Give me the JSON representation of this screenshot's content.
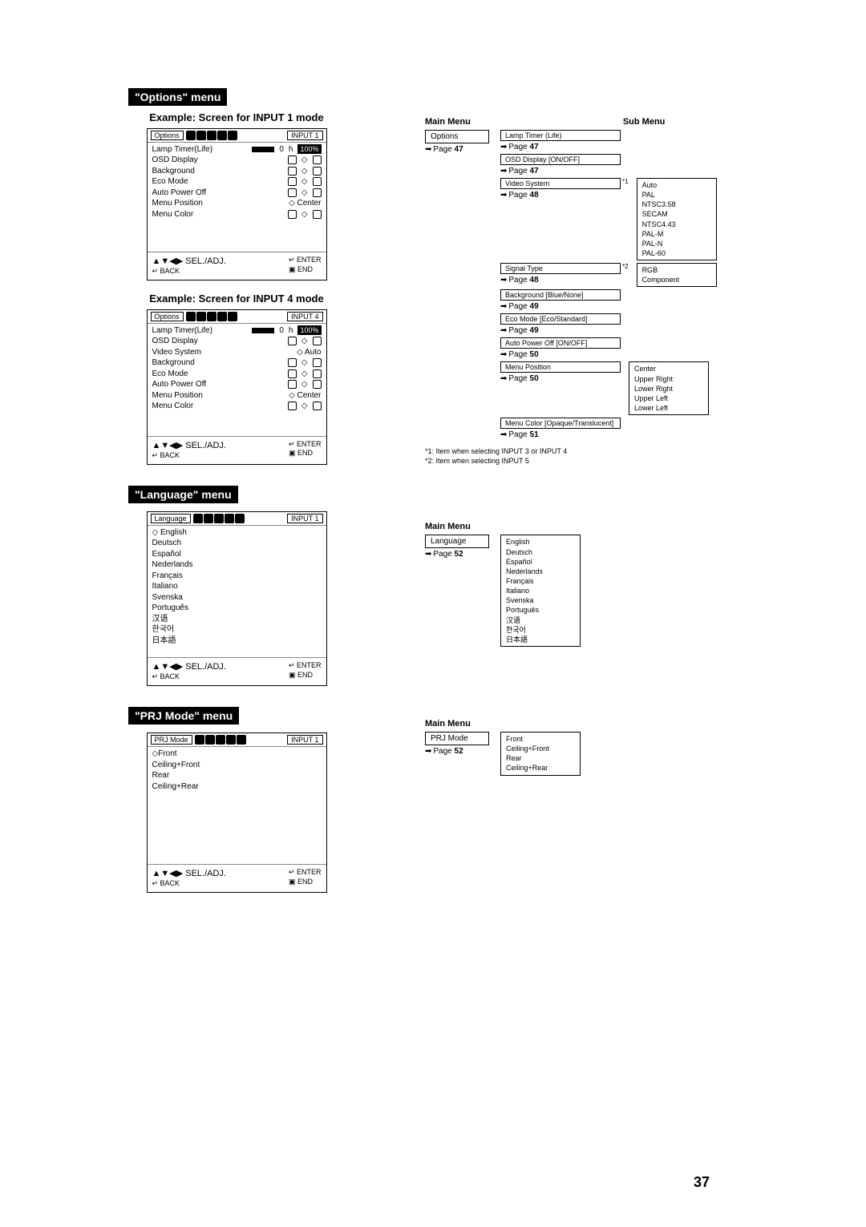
{
  "pageNumber": "37",
  "optionsMenu": {
    "header": "\"Options\" menu",
    "example1Title": "Example: Screen for INPUT 1 mode",
    "example4Title": "Example: Screen for INPUT 4 mode",
    "osd1": {
      "tab": "Options",
      "inputBadge": "INPUT 1",
      "rows": [
        {
          "label": "Lamp Timer(Life)",
          "right": "0_h_100"
        },
        {
          "label": "OSD Display",
          "right": "icons2"
        },
        {
          "label": "Background",
          "right": "icons2"
        },
        {
          "label": "Eco Mode",
          "right": "icons2"
        },
        {
          "label": "Auto Power Off",
          "right": "icons2"
        },
        {
          "label": "Menu Position",
          "right": "Center"
        },
        {
          "label": "Menu Color",
          "right": "icons2"
        }
      ]
    },
    "osd4": {
      "tab": "Options",
      "inputBadge": "INPUT 4",
      "rows": [
        {
          "label": "Lamp Timer(Life)",
          "right": "0_h_100"
        },
        {
          "label": "OSD Display",
          "right": "icons2"
        },
        {
          "label": "Video System",
          "right": "Auto"
        },
        {
          "label": "Background",
          "right": "icons2"
        },
        {
          "label": "Eco Mode",
          "right": "icons2"
        },
        {
          "label": "Auto Power Off",
          "right": "icons2"
        },
        {
          "label": "Menu Position",
          "right": "Center"
        },
        {
          "label": "Menu Color",
          "right": "icons2"
        }
      ]
    },
    "footer": {
      "left1": "▲▼◀▶ SEL./ADJ.",
      "left2": "↵ BACK",
      "right1": "↵ ENTER",
      "right2": "▣ END"
    },
    "tree": {
      "mainTitle": "Main Menu",
      "subTitle": "Sub Menu",
      "mainBox": "Options",
      "mainPage": "47",
      "items": [
        {
          "label": "Lamp Timer (Life)",
          "page": "47"
        },
        {
          "label": "OSD Display [ON/OFF]",
          "page": "47"
        },
        {
          "label": "Video System",
          "page": "48",
          "note": "*1",
          "opts": [
            "Auto",
            "PAL",
            "NTSC3.58",
            "SECAM",
            "NTSC4.43",
            "PAL-M",
            "PAL-N",
            "PAL-60"
          ]
        },
        {
          "label": "Signal Type",
          "page": "48",
          "note": "*2",
          "opts": [
            "RGB",
            "Component"
          ]
        },
        {
          "label": "Background [Blue/None]",
          "page": "49"
        },
        {
          "label": "Eco Mode [Eco/Standard]",
          "page": "49"
        },
        {
          "label": "Auto Power Off [ON/OFF]",
          "page": "50"
        },
        {
          "label": "Menu Position",
          "page": "50",
          "opts": [
            "Center",
            "Upper Right",
            "Lower Right",
            "Upper Left",
            "Lower Left"
          ]
        },
        {
          "label": "Menu Color [Opaque/Translucent]",
          "page": "51"
        }
      ],
      "notes": [
        "*1: Item when selecting INPUT 3 or INPUT 4",
        "*2: Item when selecting INPUT 5"
      ]
    }
  },
  "languageMenu": {
    "header": "\"Language\" menu",
    "osd": {
      "tab": "Language",
      "inputBadge": "INPUT 1",
      "items": [
        "English",
        "Deutsch",
        "Español",
        "Nederlands",
        "Français",
        "Italiano",
        "Svenska",
        "Português",
        "汉语",
        "한국어",
        "日本語"
      ]
    },
    "tree": {
      "mainTitle": "Main Menu",
      "mainBox": "Language",
      "mainPage": "52",
      "opts": [
        "English",
        "Deutsch",
        "Español",
        "Nederlands",
        "Français",
        "Italiano",
        "Svenska",
        "Português",
        "汉语",
        "한국어",
        "日本語"
      ]
    }
  },
  "prjMenu": {
    "header": "\"PRJ Mode\" menu",
    "osd": {
      "tab": "PRJ Mode",
      "inputBadge": "INPUT 1",
      "items": [
        "Front",
        "Ceiling+Front",
        "Rear",
        "Ceiling+Rear"
      ]
    },
    "tree": {
      "mainTitle": "Main Menu",
      "mainBox": "PRJ Mode",
      "mainPage": "52",
      "opts": [
        "Front",
        "Ceiling+Front",
        "Rear",
        "Ceiling+Rear"
      ]
    }
  }
}
